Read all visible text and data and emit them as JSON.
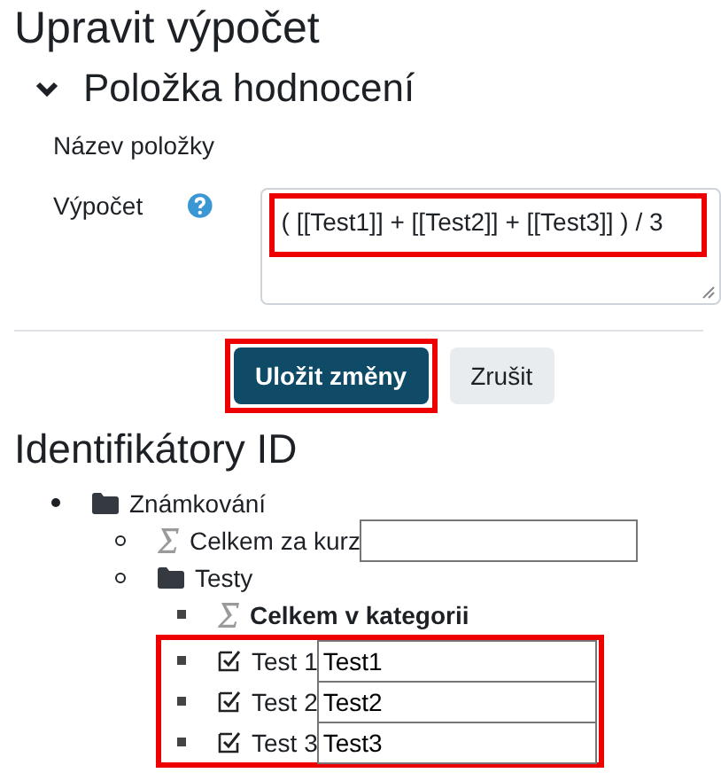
{
  "page_title": "Upravit výpočet",
  "section": {
    "title": "Položka hodnocení",
    "expanded": true
  },
  "fields": [
    {
      "kind": "text",
      "label": "Název položky"
    },
    {
      "kind": "formula",
      "label": "Výpočet",
      "help": true,
      "value": "( [[Test1]] + [[Test2]] + [[Test3]] ) / 3",
      "highlighted": true
    }
  ],
  "buttons": [
    {
      "label": "Uložit změny",
      "primary": true,
      "highlighted": true
    },
    {
      "label": "Zrušit",
      "primary": false,
      "highlighted": false
    }
  ],
  "ids_heading": "Identifikátory ID",
  "tree": [
    {
      "kind": "category",
      "label": "Známkování",
      "children": [
        {
          "kind": "total",
          "label": "Celkem za kurz",
          "bold": false,
          "id_field": true
        },
        {
          "kind": "category",
          "label": "Testy",
          "children": [
            {
              "kind": "total",
              "label": "Celkem v kategorii",
              "bold": true,
              "id_field": false
            },
            {
              "kind": "item",
              "label": "Test 1",
              "id_field": true,
              "id_value": "Test1",
              "highlighted": true
            },
            {
              "kind": "item",
              "label": "Test 2",
              "id_field": true,
              "id_value": "Test2",
              "highlighted": true
            },
            {
              "kind": "item",
              "label": "Test 3",
              "id_field": true,
              "id_value": "Test3",
              "highlighted": true
            }
          ]
        }
      ]
    }
  ]
}
